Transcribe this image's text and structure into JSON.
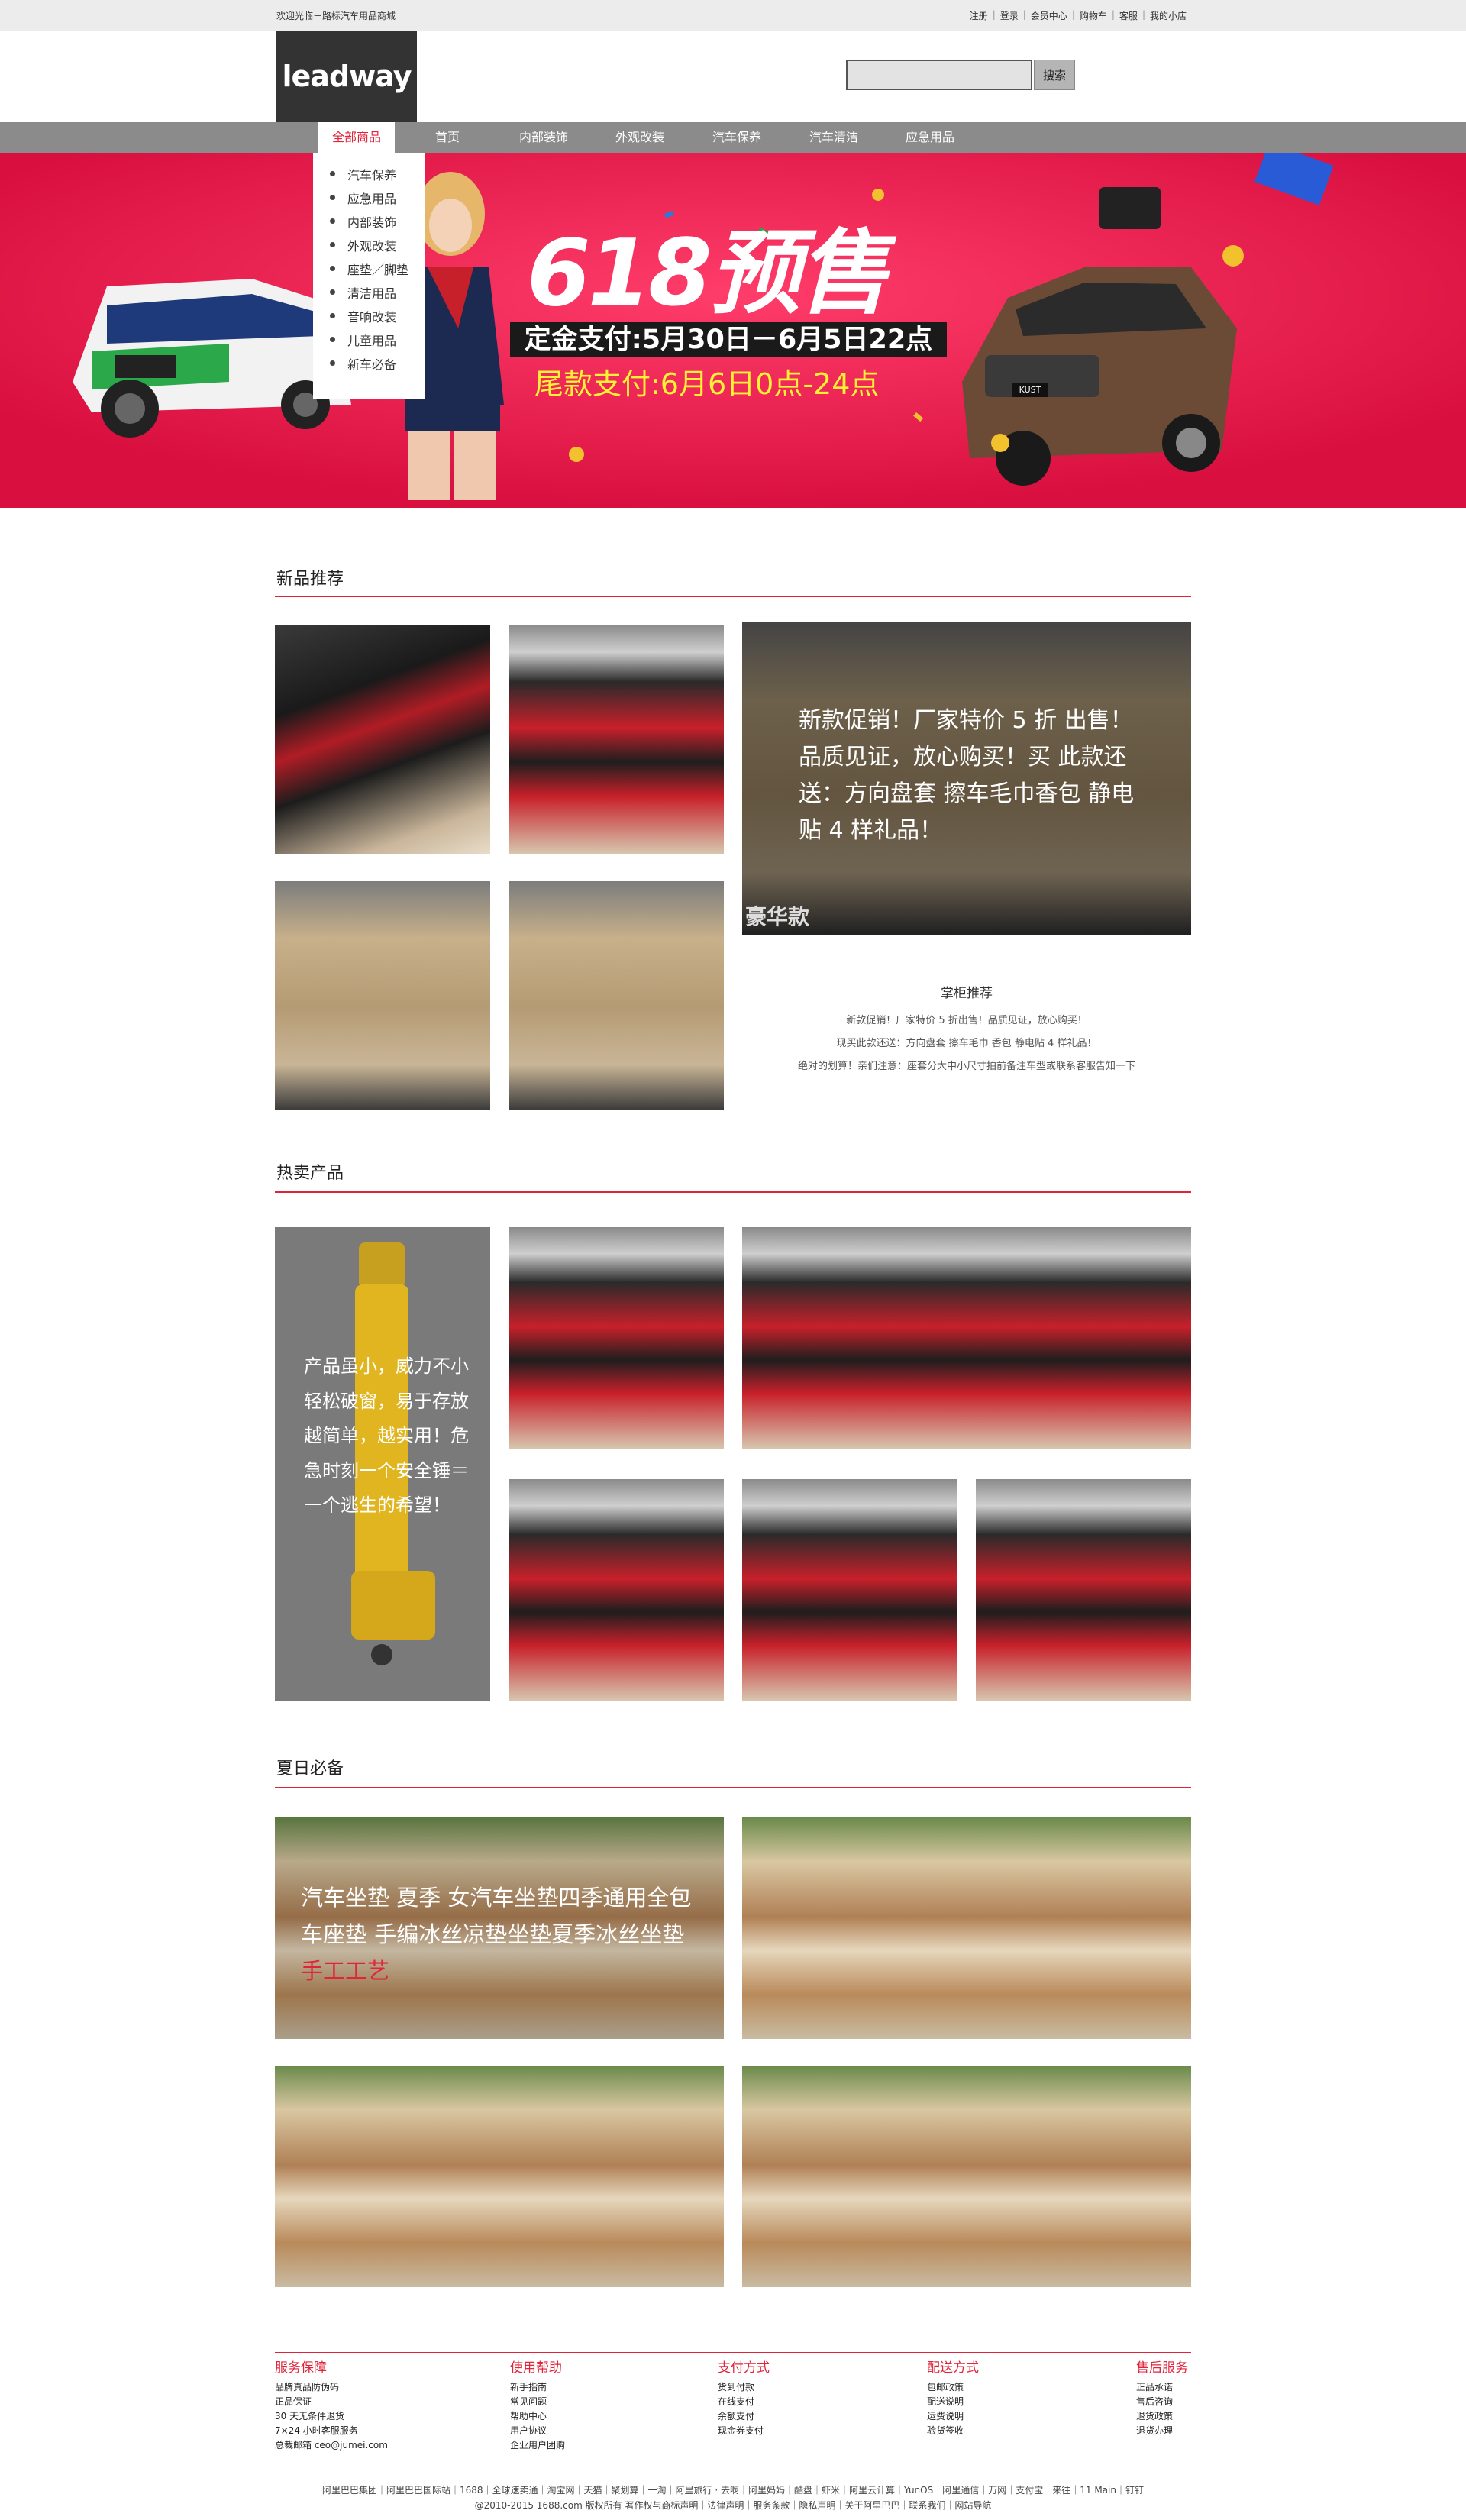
{
  "topbar": {
    "welcome": "欢迎光临－路标汽车用品商城",
    "links": [
      "注册",
      "登录",
      "会员中心",
      "购物车",
      "客服",
      "我的小店"
    ]
  },
  "header": {
    "logo": "leadway",
    "search_placeholder": "",
    "search_button": "搜索"
  },
  "nav": {
    "items": [
      "全部商品",
      "首页",
      "内部装饰",
      "外观改装",
      "汽车保养",
      "汽车清洁",
      "应急用品"
    ]
  },
  "category_menu": [
    "汽车保养",
    "应急用品",
    "内部装饰",
    "外观改装",
    "座垫／脚垫",
    "清洁用品",
    "音响改装",
    "儿童用品",
    "新车必备"
  ],
  "banner": {
    "headline": "618预售",
    "line1": "定金支付:5月30日－6月5日22点",
    "line2": "尾款支付:6月6日0点-24点",
    "car_plate": "KUST"
  },
  "new_products": {
    "title": "新品推荐",
    "promo_text": "新款促销！厂家特价 5 折 出售！品质见证，放心购买！买 此款还送：方向盘套 擦车毛巾香包 静电贴 4 样礼品！",
    "promo_tag": "豪华款",
    "rec_title": "掌柜推荐",
    "rec_lines": [
      "新款促销！厂家特价 5 折出售！品质见证，放心购买！",
      "现买此款还送：方向盘套 擦车毛巾 香包 静电贴 4 样礼品！",
      "绝对的划算！亲们注意：座套分大中小尺寸拍前备注车型或联系客服告知一下"
    ]
  },
  "hot_products": {
    "title": "热卖产品",
    "promo_text": "产品虽小，威力不小轻松破窗，易于存放越简单，越实用！危急时刻一个安全锤＝一个逃生的希望！"
  },
  "summer": {
    "title": "夏日必备",
    "promo_text": "汽车坐垫 夏季 女汽车坐垫四季通用全包车座垫 手编冰丝凉垫坐垫夏季冰丝坐垫",
    "promo_red": "手工工艺"
  },
  "footer": {
    "columns": [
      {
        "head": "服务保障",
        "items": [
          "品牌真品防伪码",
          "正品保证",
          "30 天无条件退货",
          "7×24 小时客服服务",
          "总裁邮箱 ceo@jumei.com"
        ]
      },
      {
        "head": "使用帮助",
        "items": [
          "新手指南",
          "常见问题",
          "帮助中心",
          "用户协议",
          "企业用户团购"
        ]
      },
      {
        "head": "支付方式",
        "items": [
          "货到付款",
          "在线支付",
          "余额支付",
          "现金券支付"
        ]
      },
      {
        "head": "配送方式",
        "items": [
          "包邮政策",
          "配送说明",
          "运费说明",
          "验货签收"
        ]
      },
      {
        "head": "售后服务",
        "items": [
          "正品承诺",
          "售后咨询",
          "退货政策",
          "退货办理"
        ]
      }
    ],
    "links_line": "阿里巴巴集团｜阿里巴巴国际站｜1688｜全球速卖通｜淘宝网｜天猫｜聚划算｜一淘｜阿里旅行 · 去啊｜阿里妈妈｜酷盘｜虾米｜阿里云计算｜YunOS｜阿里通信｜万网｜支付宝｜来往｜11 Main｜钉钉",
    "copyright_line": "@2010-2015 1688.com 版权所有 著作权与商标声明｜法律声明｜服务条款｜隐私声明｜关于阿里巴巴｜联系我们｜网站导航"
  },
  "colors": {
    "accent": "#e0243a",
    "banner_bg": "#e01a4f",
    "nav_bg": "#8b8b8b",
    "topbar_bg": "#ececec"
  }
}
